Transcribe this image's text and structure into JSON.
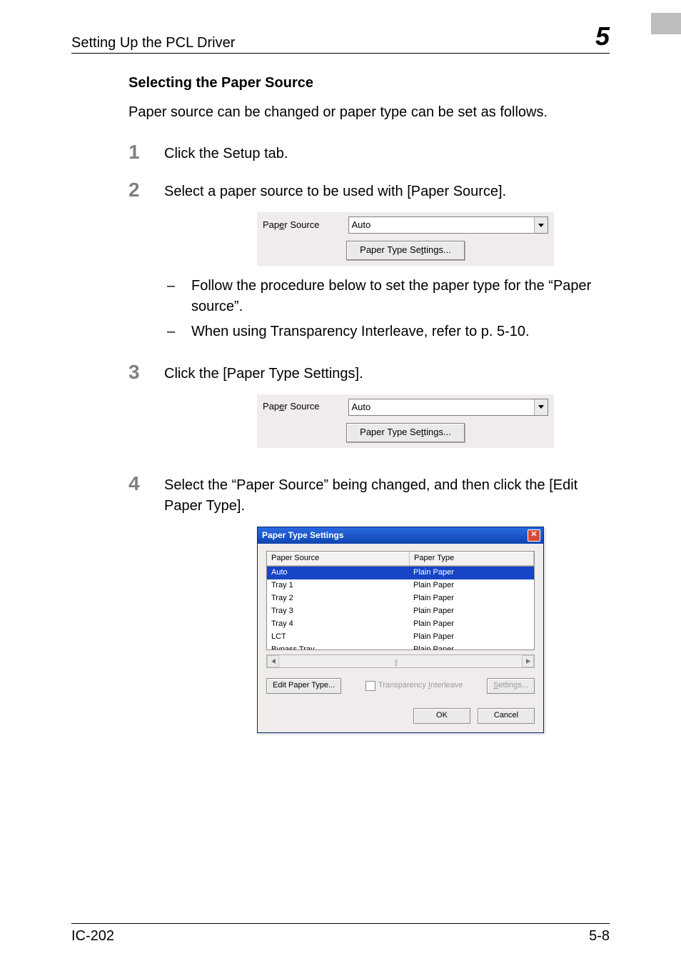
{
  "header": {
    "section_title": "Setting Up the PCL Driver",
    "chapter_number": "5"
  },
  "section_heading": "Selecting the Paper Source",
  "intro_text": "Paper source can be changed or paper type can be set as follows.",
  "steps": {
    "s1": {
      "num": "1",
      "text": "Click the Setup tab."
    },
    "s2": {
      "num": "2",
      "text": "Select a paper source to be used with [Paper Source].",
      "bullets": [
        "Follow the procedure below to set the paper type for the “Paper source”.",
        "When using Transparency Interleave, refer to p. 5-10."
      ]
    },
    "s3": {
      "num": "3",
      "text": "Click the [Paper Type Settings]."
    },
    "s4": {
      "num": "4",
      "text": "Select the “Paper Source” being changed, and then click the [Edit Paper Type]."
    }
  },
  "ps_control": {
    "label_pre": "Pap",
    "label_ul": "e",
    "label_post": "r Source",
    "value": "Auto",
    "button_pre": "Paper Type Se",
    "button_ul": "t",
    "button_post": "tings..."
  },
  "dialog": {
    "title": "Paper Type Settings",
    "col_source": "Paper Source",
    "col_type": "Paper Type",
    "rows": [
      {
        "source": "Auto",
        "type": "Plain Paper",
        "selected": true
      },
      {
        "source": "Tray 1",
        "type": "Plain Paper",
        "selected": false
      },
      {
        "source": "Tray 2",
        "type": "Plain Paper",
        "selected": false
      },
      {
        "source": "Tray 3",
        "type": "Plain Paper",
        "selected": false
      },
      {
        "source": "Tray 4",
        "type": "Plain Paper",
        "selected": false
      },
      {
        "source": "LCT",
        "type": "Plain Paper",
        "selected": false
      },
      {
        "source": "Bypass Tray",
        "type": "Plain Paper",
        "selected": false
      }
    ],
    "edit_pre": "",
    "edit_ul": "E",
    "edit_post": "dit Paper Type...",
    "transparency_pre": "Transparency ",
    "transparency_ul": "I",
    "transparency_post": "nterleave",
    "settings_pre": "",
    "settings_ul": "S",
    "settings_post": "ettings...",
    "ok": "OK",
    "cancel": "Cancel"
  },
  "footer": {
    "left": "IC-202",
    "right": "5-8"
  }
}
